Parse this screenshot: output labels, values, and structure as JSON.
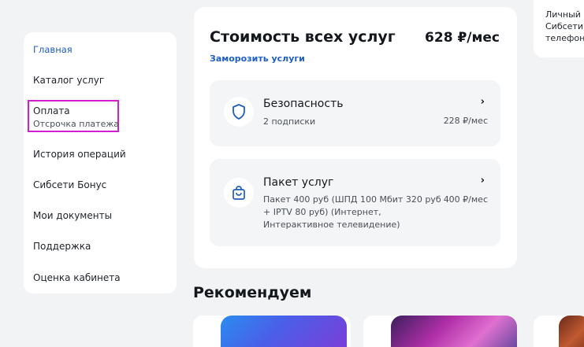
{
  "sidebar": {
    "items": [
      {
        "label": "Главная"
      },
      {
        "label": "Каталог услуг"
      },
      {
        "label": "Оплата",
        "sub": "Отсрочка платежа"
      },
      {
        "label": "История операций"
      },
      {
        "label": "Сибсети Бонус"
      },
      {
        "label": "Мои документы"
      },
      {
        "label": "Поддержка"
      },
      {
        "label": "Оценка кабинета"
      }
    ]
  },
  "summary": {
    "title": "Стоимость всех услуг",
    "total": "628 ₽/мес",
    "freeze_link": "Заморозить услуги"
  },
  "services": [
    {
      "name": "Безопасность",
      "sub": "2 подписки",
      "price": "228 ₽/мес",
      "icon": "shield-icon"
    },
    {
      "name": "Пакет услуг",
      "sub_lines": [
        "Пакет 400 руб (ШПД 100 Мбит 320 руб",
        "+ IPTV 80 руб) (Интернет,",
        "Интерактивное телевидение)"
      ],
      "price": "400 ₽/мес",
      "icon": "shopping-bag-icon"
    }
  ],
  "recommend": {
    "title": "Рекомендуем"
  },
  "right_panel": {
    "lines": [
      "Личный к",
      "Сибсети",
      "телефон"
    ]
  },
  "colors": {
    "accent": "#1f5fbf",
    "highlight": "#d21fd4",
    "page_bg": "#f2f3f5"
  }
}
